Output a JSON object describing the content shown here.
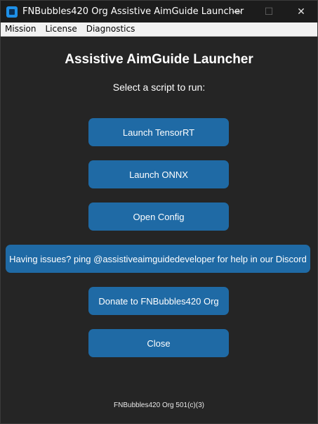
{
  "window": {
    "title": "FNBubbles420 Org Assistive AimGuide Launcher",
    "minimize_glyph": "—",
    "maximize_glyph": "☐",
    "close_glyph": "✕"
  },
  "menubar": {
    "items": [
      "Mission",
      "License",
      "Diagnostics"
    ]
  },
  "main": {
    "heading": "Assistive AimGuide Launcher",
    "subheading": "Select a script to run:",
    "buttons": {
      "launch_tensorrt": "Launch TensorRT",
      "launch_onnx": "Launch ONNX",
      "open_config": "Open Config",
      "help": "Having issues? ping @assistiveaimguidedeveloper for help in our Discord",
      "donate": "Donate to FNBubbles420 Org",
      "close": "Close"
    },
    "footer": "FNBubbles420 Org 501(c)(3)"
  },
  "colors": {
    "accent": "#1f6aa5",
    "background": "#252525"
  }
}
